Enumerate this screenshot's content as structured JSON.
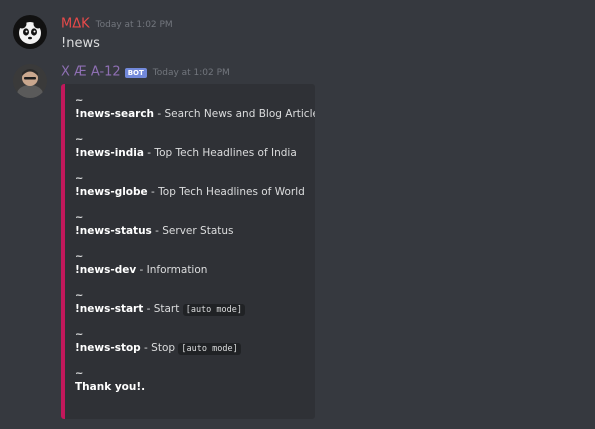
{
  "messages": [
    {
      "username": "MΔK",
      "username_color": "#e84a4a",
      "timestamp": "Today at 1:02 PM",
      "content": "!news",
      "avatar": "panda-avatar-icon"
    },
    {
      "username": "X Æ A-12",
      "username_color": "#8e6fb3",
      "bot_tag": "BOT",
      "timestamp": "Today at 1:02 PM",
      "avatar": "user-photo-avatar",
      "embed": {
        "accent_color": "#c2185b",
        "separator": "~",
        "lines": [
          {
            "command": "!news-search",
            "description": " - Search News and Blog Articles"
          },
          {
            "command": "!news-india",
            "description": " - Top Tech Headlines of India"
          },
          {
            "command": "!news-globe",
            "description": " - Top Tech Headlines of World"
          },
          {
            "command": "!news-status",
            "description": " - Server Status"
          },
          {
            "command": "!news-dev",
            "description": " - Information"
          },
          {
            "command": "!news-start",
            "description": " - Start ",
            "code": "[auto mode]"
          },
          {
            "command": "!news-stop",
            "description": " - Stop ",
            "code": "[auto mode]"
          }
        ],
        "footer": "Thank you!."
      }
    }
  ]
}
